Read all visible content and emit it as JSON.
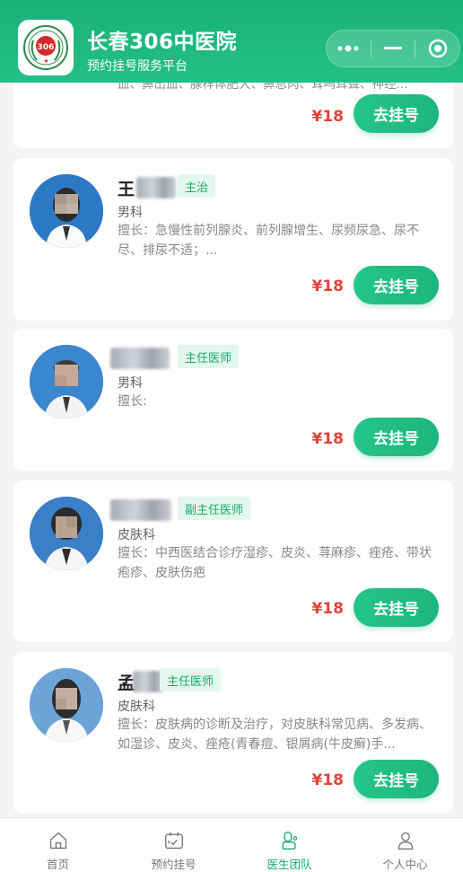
{
  "header": {
    "title": "长春306中医院",
    "subtitle": "预约挂号服务平台",
    "logo_text": "306"
  },
  "capsule": {
    "more_icon": "more-dots-icon",
    "minimize_icon": "minimize-icon",
    "close_icon": "target-close-icon"
  },
  "partial_card": {
    "specialty": "血、鼻出血、腺样体肥大、鼻息肉、耳鸣耳聋、神经...",
    "price": "¥18",
    "button": "去挂号"
  },
  "doctors": [
    {
      "name": "王",
      "title": "主治",
      "dept": "男科",
      "specialty": "擅长：急慢性前列腺炎、前列腺增生、尿频尿急、尿不尽、排尿不适；...",
      "price": "¥18",
      "button": "去挂号"
    },
    {
      "name": "",
      "title": "主任医师",
      "dept": "男科",
      "specialty": "擅长:",
      "price": "¥18",
      "button": "去挂号"
    },
    {
      "name": "",
      "title": "副主任医师",
      "dept": "皮肤科",
      "specialty": "擅长：中西医结合诊疗湿疹、皮炎、荨麻疹、痤疮、带状疱疹、皮肤伤疤",
      "price": "¥18",
      "button": "去挂号"
    },
    {
      "name": "孟",
      "title": "主任医师",
      "dept": "皮肤科",
      "specialty": "擅长：皮肤病的诊断及治疗，对皮肤科常见病、多发病、如湿诊、皮炎、痤疮(青春痘、银屑病(牛皮癣)手...",
      "price": "¥18",
      "button": "去挂号"
    }
  ],
  "tabbar": [
    {
      "label": "首页",
      "icon": "home-icon",
      "active": false
    },
    {
      "label": "预约挂号",
      "icon": "calendar-icon",
      "active": false
    },
    {
      "label": "医生团队",
      "icon": "doctor-icon",
      "active": true
    },
    {
      "label": "个人中心",
      "icon": "user-icon",
      "active": false
    }
  ],
  "colors": {
    "brand": "#1db57e",
    "price": "#e5413a",
    "badge_bg": "#e3f7ee"
  }
}
